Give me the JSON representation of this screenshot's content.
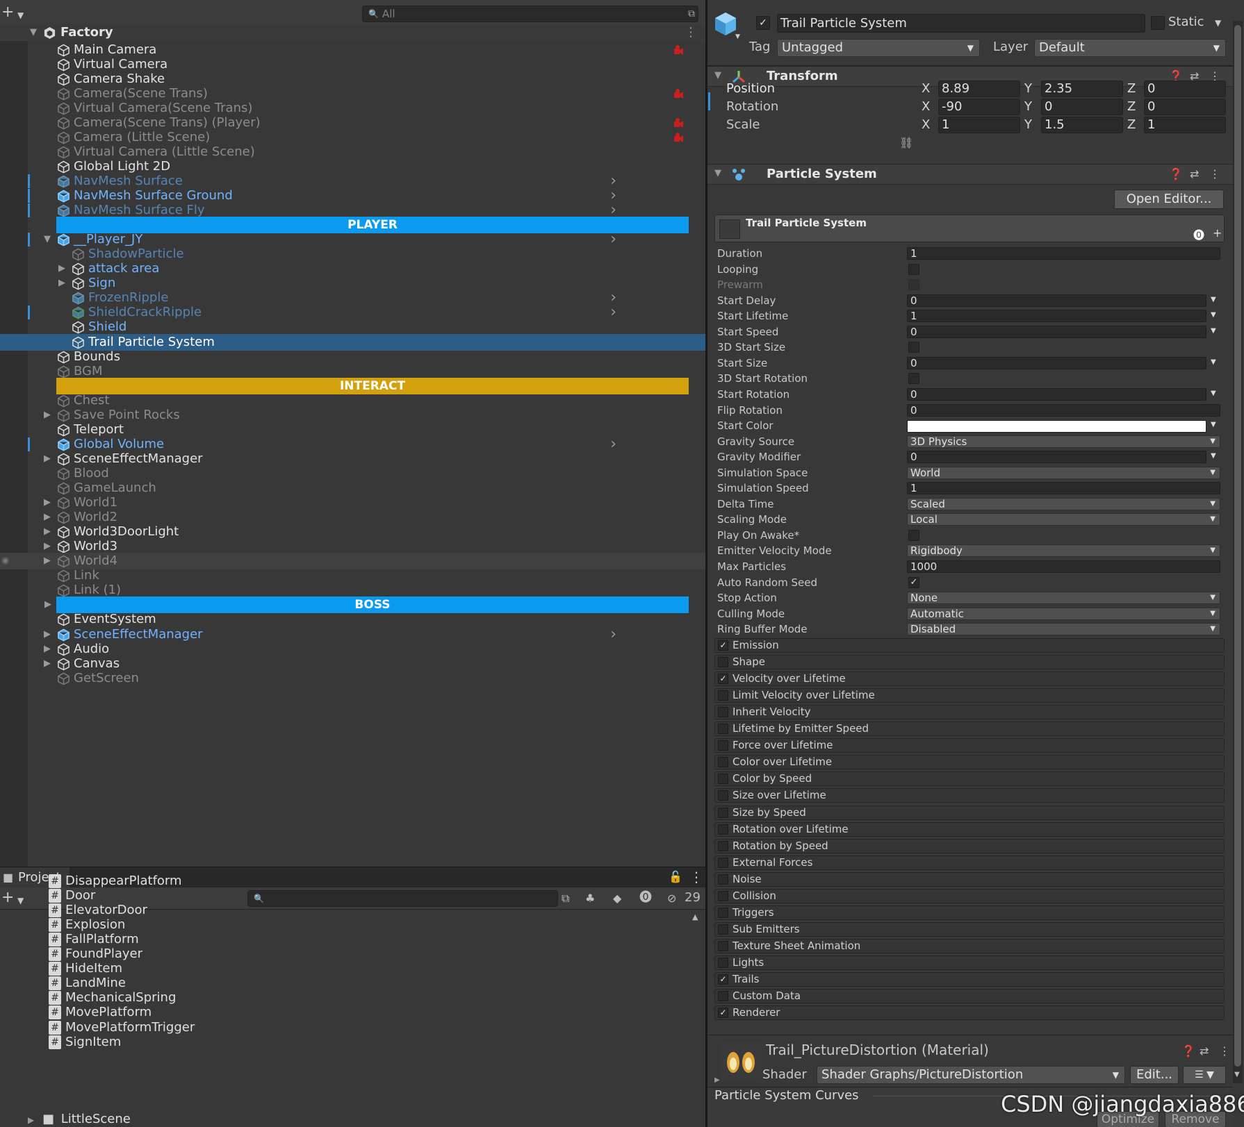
{
  "hierarchy": {
    "search_placeholder": "All",
    "scene": {
      "name": "Factory"
    },
    "rows": [
      {
        "label": "Main Camera",
        "indent": 1,
        "color": "white",
        "red": true
      },
      {
        "label": "Virtual Camera",
        "indent": 1,
        "color": "white"
      },
      {
        "label": "Camera Shake",
        "indent": 1,
        "color": "white"
      },
      {
        "label": "Camera(Scene Trans)",
        "indent": 1,
        "color": "gray",
        "red": true
      },
      {
        "label": "Virtual Camera(Scene Trans)",
        "indent": 1,
        "color": "gray"
      },
      {
        "label": "Camera(Scene Trans) (Player)",
        "indent": 1,
        "color": "gray",
        "red": true
      },
      {
        "label": "Camera (Little Scene)",
        "indent": 1,
        "color": "gray",
        "red": true
      },
      {
        "label": "Virtual Camera (Little Scene)",
        "indent": 1,
        "color": "gray"
      },
      {
        "label": "Global Light 2D",
        "indent": 1,
        "color": "white"
      },
      {
        "label": "NavMesh Surface",
        "indent": 1,
        "color": "dimblue",
        "prefab": true,
        "bar": true,
        "chev": true
      },
      {
        "label": "NavMesh Surface Ground",
        "indent": 1,
        "color": "blue",
        "prefab": true,
        "bar": true,
        "chev": true
      },
      {
        "label": "NavMesh Surface Fly",
        "indent": 1,
        "color": "dimblue",
        "prefab": true,
        "bar": true,
        "chev": true
      },
      {
        "banner": "PLAYER",
        "bannerColor": "#0a9bf0"
      },
      {
        "label": "__Player_JY",
        "indent": 1,
        "color": "blue",
        "prefab": true,
        "bar": true,
        "chev": true,
        "arrow": "open"
      },
      {
        "label": "ShadowParticle",
        "indent": 2,
        "color": "dimblue"
      },
      {
        "label": "attack area",
        "indent": 2,
        "color": "blue",
        "arrow": "closed"
      },
      {
        "label": "Sign",
        "indent": 2,
        "color": "blue",
        "arrow": "closed"
      },
      {
        "label": "FrozenRipple",
        "indent": 2,
        "color": "dimblue",
        "prefab": true,
        "chev": true
      },
      {
        "label": "ShieldCrackRipple",
        "indent": 2,
        "color": "dimblue",
        "prefab": true,
        "green": true,
        "bar": true,
        "chev": true
      },
      {
        "label": "Shield",
        "indent": 2,
        "color": "blue"
      },
      {
        "label": "Trail Particle System",
        "indent": 2,
        "color": "selw",
        "selected": true
      },
      {
        "label": "Bounds",
        "indent": 1,
        "color": "white"
      },
      {
        "label": "BGM",
        "indent": 1,
        "color": "gray"
      },
      {
        "banner": "INTERACT",
        "bannerColor": "#d4a10e"
      },
      {
        "label": "Chest",
        "indent": 1,
        "color": "gray"
      },
      {
        "label": "Save Point Rocks",
        "indent": 1,
        "color": "gray",
        "arrow": "closed"
      },
      {
        "label": "Teleport",
        "indent": 1,
        "color": "white"
      },
      {
        "label": "Global Volume",
        "indent": 1,
        "color": "blue",
        "prefab": true,
        "bar": true,
        "chev": true
      },
      {
        "label": "SceneEffectManager",
        "indent": 1,
        "color": "white",
        "arrow": "closed"
      },
      {
        "label": "Blood",
        "indent": 1,
        "color": "gray"
      },
      {
        "label": "GameLaunch",
        "indent": 1,
        "color": "gray"
      },
      {
        "label": "World1",
        "indent": 1,
        "color": "gray",
        "arrow": "closed"
      },
      {
        "label": "World2",
        "indent": 1,
        "color": "gray",
        "arrow": "closed"
      },
      {
        "label": "World3DoorLight",
        "indent": 1,
        "color": "white",
        "arrow": "closed"
      },
      {
        "label": "World3",
        "indent": 1,
        "color": "white",
        "arrow": "closed"
      },
      {
        "label": "World4",
        "indent": 1,
        "color": "gray",
        "arrow": "closed",
        "hidden": true
      },
      {
        "label": "Link",
        "indent": 1,
        "color": "gray"
      },
      {
        "label": "Link (1)",
        "indent": 1,
        "color": "gray"
      },
      {
        "banner": "BOSS",
        "bannerColor": "#0a9bf0",
        "arrow": "closed"
      },
      {
        "label": "EventSystem",
        "indent": 1,
        "color": "white"
      },
      {
        "label": "SceneEffectManager",
        "indent": 1,
        "color": "blue",
        "prefab": true,
        "arrow": "closed",
        "chev": true
      },
      {
        "label": "Audio",
        "indent": 1,
        "color": "white",
        "arrow": "closed"
      },
      {
        "label": "Canvas",
        "indent": 1,
        "color": "white",
        "arrow": "closed"
      },
      {
        "label": "GetScreen",
        "indent": 1,
        "color": "gray"
      }
    ]
  },
  "project": {
    "tab_label": "Project",
    "hidden_count": "29",
    "items": [
      "DisappearPlatform",
      "Door",
      "ElevatorDoor",
      "Explosion",
      "FallPlatform",
      "FoundPlayer",
      "HideItem",
      "LandMine",
      "MechanicalSpring",
      "MovePlatform",
      "MovePlatformTrigger",
      "SignItem"
    ],
    "folder": "LittleScene"
  },
  "inspector": {
    "object_name": "Trail Particle System",
    "static_label": "Static",
    "tag_label": "Tag",
    "tag_value": "Untagged",
    "layer_label": "Layer",
    "layer_value": "Default",
    "transform": {
      "title": "Transform",
      "position_label": "Position",
      "rotation_label": "Rotation",
      "scale_label": "Scale",
      "position": {
        "x": "8.89",
        "y": "2.35",
        "z": "0"
      },
      "rotation": {
        "x": "-90",
        "y": "0",
        "z": "0"
      },
      "scale": {
        "x": "1",
        "y": "1.5",
        "z": "1"
      },
      "axis": {
        "x": "X",
        "y": "Y",
        "z": "Z"
      }
    },
    "particle_system": {
      "title": "Particle System",
      "open_editor": "Open Editor...",
      "main_title": "Trail Particle System",
      "props": [
        {
          "label": "Duration",
          "kind": "field",
          "value": "1"
        },
        {
          "label": "Looping",
          "kind": "check",
          "checked": false
        },
        {
          "label": "Prewarm",
          "kind": "check",
          "checked": false,
          "disabled": true
        },
        {
          "label": "Start Delay",
          "kind": "field",
          "value": "0",
          "tri": true
        },
        {
          "label": "Start Lifetime",
          "kind": "field",
          "value": "1",
          "tri": true
        },
        {
          "label": "Start Speed",
          "kind": "field",
          "value": "0",
          "tri": true
        },
        {
          "label": "3D Start Size",
          "kind": "check",
          "checked": false
        },
        {
          "label": "Start Size",
          "kind": "field",
          "value": "0",
          "tri": true
        },
        {
          "label": "3D Start Rotation",
          "kind": "check",
          "checked": false
        },
        {
          "label": "Start Rotation",
          "kind": "field",
          "value": "0",
          "tri": true
        },
        {
          "label": "Flip Rotation",
          "kind": "field",
          "value": "0"
        },
        {
          "label": "Start Color",
          "kind": "color",
          "value": "#ffffff",
          "tri": true
        },
        {
          "label": "Gravity Source",
          "kind": "dropdown",
          "value": "3D Physics"
        },
        {
          "label": "Gravity Modifier",
          "kind": "field",
          "value": "0",
          "tri": true
        },
        {
          "label": "Simulation Space",
          "kind": "dropdown",
          "value": "World"
        },
        {
          "label": "Simulation Speed",
          "kind": "field",
          "value": "1"
        },
        {
          "label": "Delta Time",
          "kind": "dropdown",
          "value": "Scaled"
        },
        {
          "label": "Scaling Mode",
          "kind": "dropdown",
          "value": "Local"
        },
        {
          "label": "Play On Awake*",
          "kind": "check",
          "checked": false
        },
        {
          "label": "Emitter Velocity Mode",
          "kind": "dropdown",
          "value": "Rigidbody"
        },
        {
          "label": "Max Particles",
          "kind": "field",
          "value": "1000"
        },
        {
          "label": "Auto Random Seed",
          "kind": "check",
          "checked": true
        },
        {
          "label": "Stop Action",
          "kind": "dropdown",
          "value": "None"
        },
        {
          "label": "Culling Mode",
          "kind": "dropdown",
          "value": "Automatic"
        },
        {
          "label": "Ring Buffer Mode",
          "kind": "dropdown",
          "value": "Disabled"
        }
      ],
      "modules": [
        {
          "label": "Emission",
          "checked": true
        },
        {
          "label": "Shape",
          "checked": false
        },
        {
          "label": "Velocity over Lifetime",
          "checked": true
        },
        {
          "label": "Limit Velocity over Lifetime",
          "checked": false
        },
        {
          "label": "Inherit Velocity",
          "checked": false
        },
        {
          "label": "Lifetime by Emitter Speed",
          "checked": false
        },
        {
          "label": "Force over Lifetime",
          "checked": false
        },
        {
          "label": "Color over Lifetime",
          "checked": false
        },
        {
          "label": "Color by Speed",
          "checked": false
        },
        {
          "label": "Size over Lifetime",
          "checked": false
        },
        {
          "label": "Size by Speed",
          "checked": false
        },
        {
          "label": "Rotation over Lifetime",
          "checked": false
        },
        {
          "label": "Rotation by Speed",
          "checked": false
        },
        {
          "label": "External Forces",
          "checked": false
        },
        {
          "label": "Noise",
          "checked": false
        },
        {
          "label": "Collision",
          "checked": false
        },
        {
          "label": "Triggers",
          "checked": false
        },
        {
          "label": "Sub Emitters",
          "checked": false
        },
        {
          "label": "Texture Sheet Animation",
          "checked": false
        },
        {
          "label": "Lights",
          "checked": false
        },
        {
          "label": "Trails",
          "checked": true
        },
        {
          "label": "Custom Data",
          "checked": false
        },
        {
          "label": "Renderer",
          "checked": true
        }
      ]
    },
    "material": {
      "name": "Trail_PictureDistortion (Material)",
      "shader_label": "Shader",
      "shader_value": "Shader Graphs/PictureDistortion",
      "edit_button": "Edit..."
    },
    "curves_title": "Particle System Curves",
    "optimize_button": "Optimize",
    "remove_button": "Remove"
  },
  "watermark": "CSDN @jiangdaxia886"
}
